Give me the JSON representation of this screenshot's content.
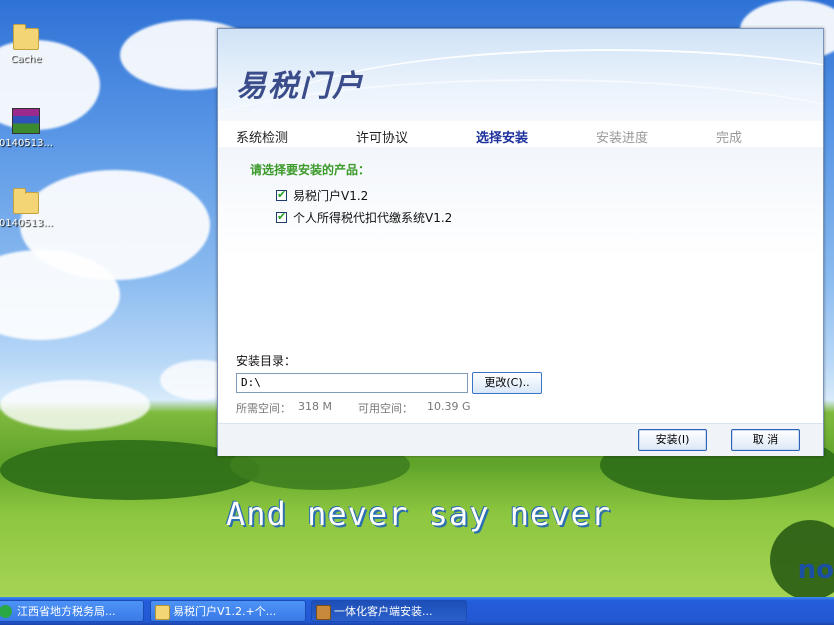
{
  "desktop": {
    "icons": [
      {
        "name": "folder-icon",
        "label": "Cache"
      },
      {
        "name": "rar-archive-icon",
        "label": "0140513..."
      },
      {
        "name": "folder-icon",
        "label": "0140513..."
      }
    ],
    "slogan": "And never say never",
    "corner_text": "no"
  },
  "installer": {
    "title": "易税门户",
    "steps": [
      {
        "label": "系统检测",
        "state": "done"
      },
      {
        "label": "许可协议",
        "state": "done"
      },
      {
        "label": "选择安装",
        "state": "active"
      },
      {
        "label": "安装进度",
        "state": "pending"
      },
      {
        "label": "完成",
        "state": "pending"
      }
    ],
    "prompt": "请选择要安装的产品：",
    "products": [
      {
        "label": "易税门户V1.2",
        "checked": true
      },
      {
        "label": "个人所得税代扣代缴系统V1.2",
        "checked": true
      }
    ],
    "dir_label": "安装目录：",
    "dir_value": "D:\\",
    "change_label": "更改(C)..",
    "required_label": "所需空间：",
    "required_value": "318 M",
    "available_label": "可用空间：",
    "available_value": "10.39 G",
    "install_label": "安装(I)",
    "cancel_label": "取 消"
  },
  "taskbar": {
    "items": [
      {
        "label": "江西省地方税务局...",
        "icon": "ie-icon"
      },
      {
        "label": "易税门户V1.2.+个...",
        "icon": "folder-icon"
      },
      {
        "label": "一体化客户端安装...",
        "icon": "installer-icon"
      }
    ]
  },
  "colors": {
    "prompt": "#3c9a2a",
    "active_step": "#1c2f9c",
    "title": "#3a4d8a",
    "taskbar": "#245edb"
  }
}
